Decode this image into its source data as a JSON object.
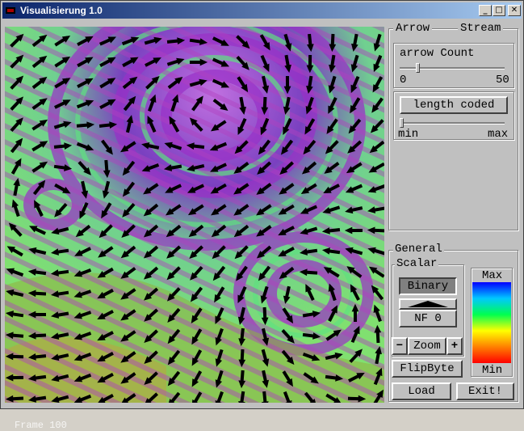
{
  "window": {
    "title": "Visualisierung 1.0",
    "controls": {
      "minimize": "_",
      "maximize": "□",
      "close": "✕"
    }
  },
  "tabs": [
    {
      "label": "Arrow",
      "active": true
    },
    {
      "label": "Stream",
      "active": false
    }
  ],
  "arrow_panel": {
    "arrow_count": {
      "label": "arrow Count",
      "min": "0",
      "max": "50",
      "value": 12
    },
    "length_coded": {
      "label": "length coded",
      "min": "min",
      "max": "max",
      "value": 0
    }
  },
  "general": {
    "label": "General",
    "scalar_label": "Scalar",
    "binary_button": "Binary",
    "nf_label": "NF 0",
    "zoom_label": "Zoom",
    "zoom_minus": "−",
    "zoom_plus": "+",
    "flipbyte_button": "FlipByte",
    "colorbar": {
      "max_label": "Max",
      "min_label": "Min",
      "colors": [
        "#0000ff",
        "#00c8ff",
        "#00ff50",
        "#ffff00",
        "#ff8000",
        "#ff0000"
      ]
    }
  },
  "buttons": {
    "load": "Load",
    "exit": "Exit!"
  },
  "status_text": "Frame 100"
}
